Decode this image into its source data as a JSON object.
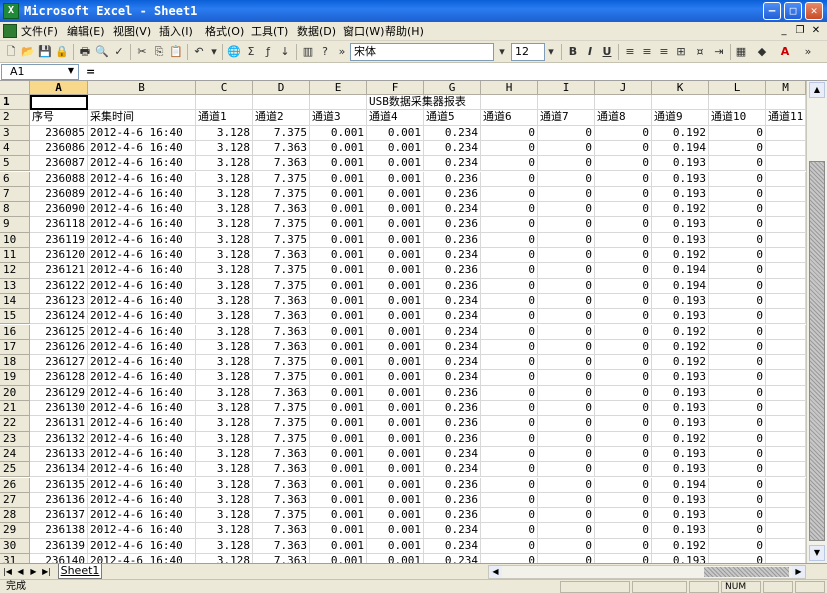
{
  "window": {
    "title": "Microsoft Excel - Sheet1",
    "app_icon": "excel-icon"
  },
  "menu": [
    "文件(F)",
    "编辑(E)",
    "视图(V)",
    "插入(I)",
    "格式(O)",
    "工具(T)",
    "数据(D)",
    "窗口(W)",
    "帮助(H)"
  ],
  "toolbar": {
    "font_name": "宋体",
    "font_size": "12",
    "bold_label": "B",
    "italic_label": "I",
    "underline_label": "U"
  },
  "formula_bar": {
    "name_box": "A1",
    "fx_label": "=",
    "value": ""
  },
  "columns": [
    "A",
    "B",
    "C",
    "D",
    "E",
    "F",
    "G",
    "H",
    "I",
    "J",
    "K",
    "L",
    "M"
  ],
  "title_row": "USB数据采集器报表",
  "headers": [
    "序号",
    "采集时间",
    "通道1",
    "通道2",
    "通道3",
    "通道4",
    "通道5",
    "通道6",
    "通道7",
    "通道8",
    "通道9",
    "通道10",
    "通道11"
  ],
  "rows": [
    [
      "3",
      "236085",
      "2012-4-6 16:40",
      "3.128",
      "7.375",
      "0.001",
      "0.001",
      "0.234",
      "0",
      "0",
      "0",
      "0.192",
      "0"
    ],
    [
      "4",
      "236086",
      "2012-4-6 16:40",
      "3.128",
      "7.363",
      "0.001",
      "0.001",
      "0.234",
      "0",
      "0",
      "0",
      "0.194",
      "0"
    ],
    [
      "5",
      "236087",
      "2012-4-6 16:40",
      "3.128",
      "7.363",
      "0.001",
      "0.001",
      "0.234",
      "0",
      "0",
      "0",
      "0.193",
      "0"
    ],
    [
      "6",
      "236088",
      "2012-4-6 16:40",
      "3.128",
      "7.375",
      "0.001",
      "0.001",
      "0.236",
      "0",
      "0",
      "0",
      "0.193",
      "0"
    ],
    [
      "7",
      "236089",
      "2012-4-6 16:40",
      "3.128",
      "7.375",
      "0.001",
      "0.001",
      "0.236",
      "0",
      "0",
      "0",
      "0.193",
      "0"
    ],
    [
      "8",
      "236090",
      "2012-4-6 16:40",
      "3.128",
      "7.363",
      "0.001",
      "0.001",
      "0.234",
      "0",
      "0",
      "0",
      "0.192",
      "0"
    ],
    [
      "9",
      "236118",
      "2012-4-6 16:40",
      "3.128",
      "7.375",
      "0.001",
      "0.001",
      "0.236",
      "0",
      "0",
      "0",
      "0.193",
      "0"
    ],
    [
      "10",
      "236119",
      "2012-4-6 16:40",
      "3.128",
      "7.375",
      "0.001",
      "0.001",
      "0.236",
      "0",
      "0",
      "0",
      "0.193",
      "0"
    ],
    [
      "11",
      "236120",
      "2012-4-6 16:40",
      "3.128",
      "7.363",
      "0.001",
      "0.001",
      "0.234",
      "0",
      "0",
      "0",
      "0.192",
      "0"
    ],
    [
      "12",
      "236121",
      "2012-4-6 16:40",
      "3.128",
      "7.375",
      "0.001",
      "0.001",
      "0.236",
      "0",
      "0",
      "0",
      "0.194",
      "0"
    ],
    [
      "13",
      "236122",
      "2012-4-6 16:40",
      "3.128",
      "7.375",
      "0.001",
      "0.001",
      "0.236",
      "0",
      "0",
      "0",
      "0.194",
      "0"
    ],
    [
      "14",
      "236123",
      "2012-4-6 16:40",
      "3.128",
      "7.363",
      "0.001",
      "0.001",
      "0.234",
      "0",
      "0",
      "0",
      "0.193",
      "0"
    ],
    [
      "15",
      "236124",
      "2012-4-6 16:40",
      "3.128",
      "7.363",
      "0.001",
      "0.001",
      "0.234",
      "0",
      "0",
      "0",
      "0.193",
      "0"
    ],
    [
      "16",
      "236125",
      "2012-4-6 16:40",
      "3.128",
      "7.363",
      "0.001",
      "0.001",
      "0.234",
      "0",
      "0",
      "0",
      "0.192",
      "0"
    ],
    [
      "17",
      "236126",
      "2012-4-6 16:40",
      "3.128",
      "7.363",
      "0.001",
      "0.001",
      "0.234",
      "0",
      "0",
      "0",
      "0.192",
      "0"
    ],
    [
      "18",
      "236127",
      "2012-4-6 16:40",
      "3.128",
      "7.375",
      "0.001",
      "0.001",
      "0.234",
      "0",
      "0",
      "0",
      "0.192",
      "0"
    ],
    [
      "19",
      "236128",
      "2012-4-6 16:40",
      "3.128",
      "7.375",
      "0.001",
      "0.001",
      "0.234",
      "0",
      "0",
      "0",
      "0.193",
      "0"
    ],
    [
      "20",
      "236129",
      "2012-4-6 16:40",
      "3.128",
      "7.363",
      "0.001",
      "0.001",
      "0.236",
      "0",
      "0",
      "0",
      "0.193",
      "0"
    ],
    [
      "21",
      "236130",
      "2012-4-6 16:40",
      "3.128",
      "7.375",
      "0.001",
      "0.001",
      "0.236",
      "0",
      "0",
      "0",
      "0.193",
      "0"
    ],
    [
      "22",
      "236131",
      "2012-4-6 16:40",
      "3.128",
      "7.375",
      "0.001",
      "0.001",
      "0.236",
      "0",
      "0",
      "0",
      "0.193",
      "0"
    ],
    [
      "23",
      "236132",
      "2012-4-6 16:40",
      "3.128",
      "7.375",
      "0.001",
      "0.001",
      "0.236",
      "0",
      "0",
      "0",
      "0.192",
      "0"
    ],
    [
      "24",
      "236133",
      "2012-4-6 16:40",
      "3.128",
      "7.363",
      "0.001",
      "0.001",
      "0.234",
      "0",
      "0",
      "0",
      "0.193",
      "0"
    ],
    [
      "25",
      "236134",
      "2012-4-6 16:40",
      "3.128",
      "7.363",
      "0.001",
      "0.001",
      "0.234",
      "0",
      "0",
      "0",
      "0.193",
      "0"
    ],
    [
      "26",
      "236135",
      "2012-4-6 16:40",
      "3.128",
      "7.363",
      "0.001",
      "0.001",
      "0.236",
      "0",
      "0",
      "0",
      "0.194",
      "0"
    ],
    [
      "27",
      "236136",
      "2012-4-6 16:40",
      "3.128",
      "7.363",
      "0.001",
      "0.001",
      "0.236",
      "0",
      "0",
      "0",
      "0.193",
      "0"
    ],
    [
      "28",
      "236137",
      "2012-4-6 16:40",
      "3.128",
      "7.375",
      "0.001",
      "0.001",
      "0.236",
      "0",
      "0",
      "0",
      "0.193",
      "0"
    ],
    [
      "29",
      "236138",
      "2012-4-6 16:40",
      "3.128",
      "7.363",
      "0.001",
      "0.001",
      "0.234",
      "0",
      "0",
      "0",
      "0.193",
      "0"
    ],
    [
      "30",
      "236139",
      "2012-4-6 16:40",
      "3.128",
      "7.363",
      "0.001",
      "0.001",
      "0.234",
      "0",
      "0",
      "0",
      "0.192",
      "0"
    ],
    [
      "31",
      "236140",
      "2012-4-6 16:40",
      "3.128",
      "7.363",
      "0.001",
      "0.001",
      "0.234",
      "0",
      "0",
      "0",
      "0.193",
      "0"
    ]
  ],
  "sheet_tab": "Sheet1",
  "status": {
    "ready": "完成",
    "mode": "NUM"
  },
  "colors": {
    "title_bar": "#1c5fd0",
    "chrome": "#ece9d8",
    "active_header": "#f8d88a"
  }
}
